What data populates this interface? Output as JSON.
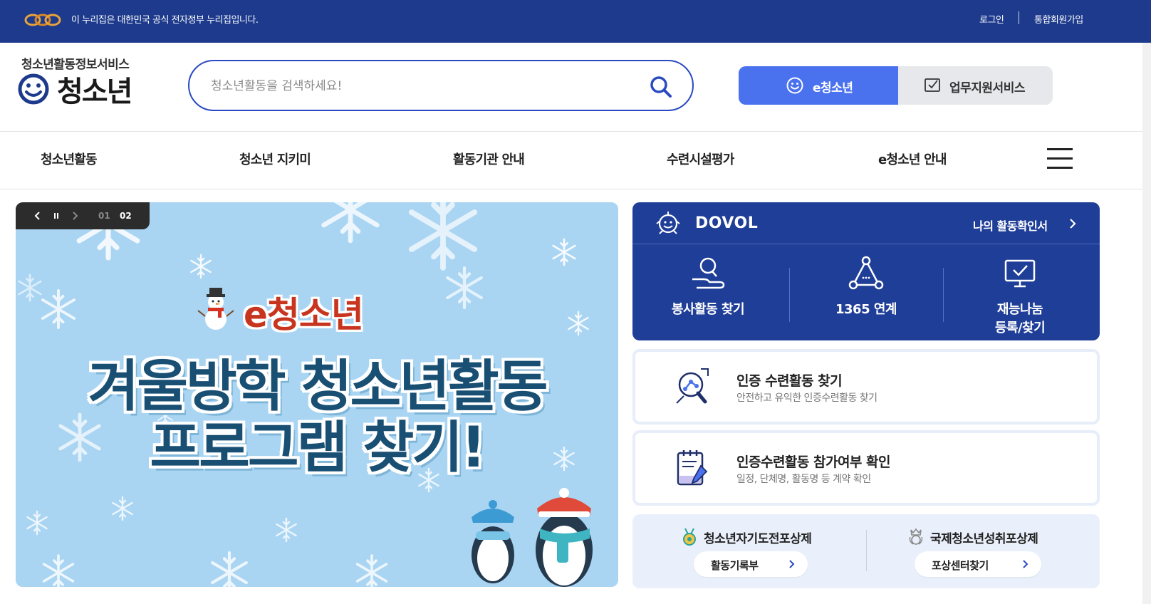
{
  "gov_bar": {
    "text": "이 누리집은 대한민국 공식 전자정부 누리집입니다.",
    "login": "로그인",
    "join": "통합회원가입"
  },
  "brand": {
    "subtitle": "청소년활동정보서비스",
    "name": "청소년"
  },
  "search": {
    "placeholder": "청소년활동을 검색하세요!",
    "value": ""
  },
  "site_tabs": {
    "e_youth": "e청소년",
    "work_support": "업무지원서비스"
  },
  "gnb": {
    "items": [
      {
        "label": "청소년활동"
      },
      {
        "label": "청소년 지키미"
      },
      {
        "label": "활동기관 안내"
      },
      {
        "label": "수련시설평가"
      },
      {
        "label": "e청소년 안내"
      }
    ]
  },
  "banner": {
    "slide_current": "02",
    "slide_other": "01",
    "brand": "e청소년",
    "line1": "겨울방학 청소년활동",
    "line2": "프로그램 찾기!"
  },
  "dovol": {
    "title": "DOVOL",
    "link": "나의 활동확인서",
    "items": [
      {
        "label": "봉사활동 찾기"
      },
      {
        "label": "1365 연계"
      },
      {
        "label_line1": "재능나눔",
        "label_line2": "등록/찾기"
      }
    ]
  },
  "cards": [
    {
      "title": "인증 수련활동 찾기",
      "desc": "안전하고 유익한 인증수련활동 찾기"
    },
    {
      "title": "인증수련활동 참가여부 확인",
      "desc": "일정, 단체명, 활동명 등 계약 확인"
    }
  ],
  "awards": [
    {
      "title": "청소년자기도전포상제",
      "button": "활동기록부"
    },
    {
      "title": "국제청소년성취포상제",
      "button": "포상센터찾기"
    }
  ],
  "colors": {
    "gov_bar": "#1d3a8c",
    "accent": "#4a72ef",
    "dovol": "#1f3e97",
    "search_border": "#2b4ac2"
  }
}
